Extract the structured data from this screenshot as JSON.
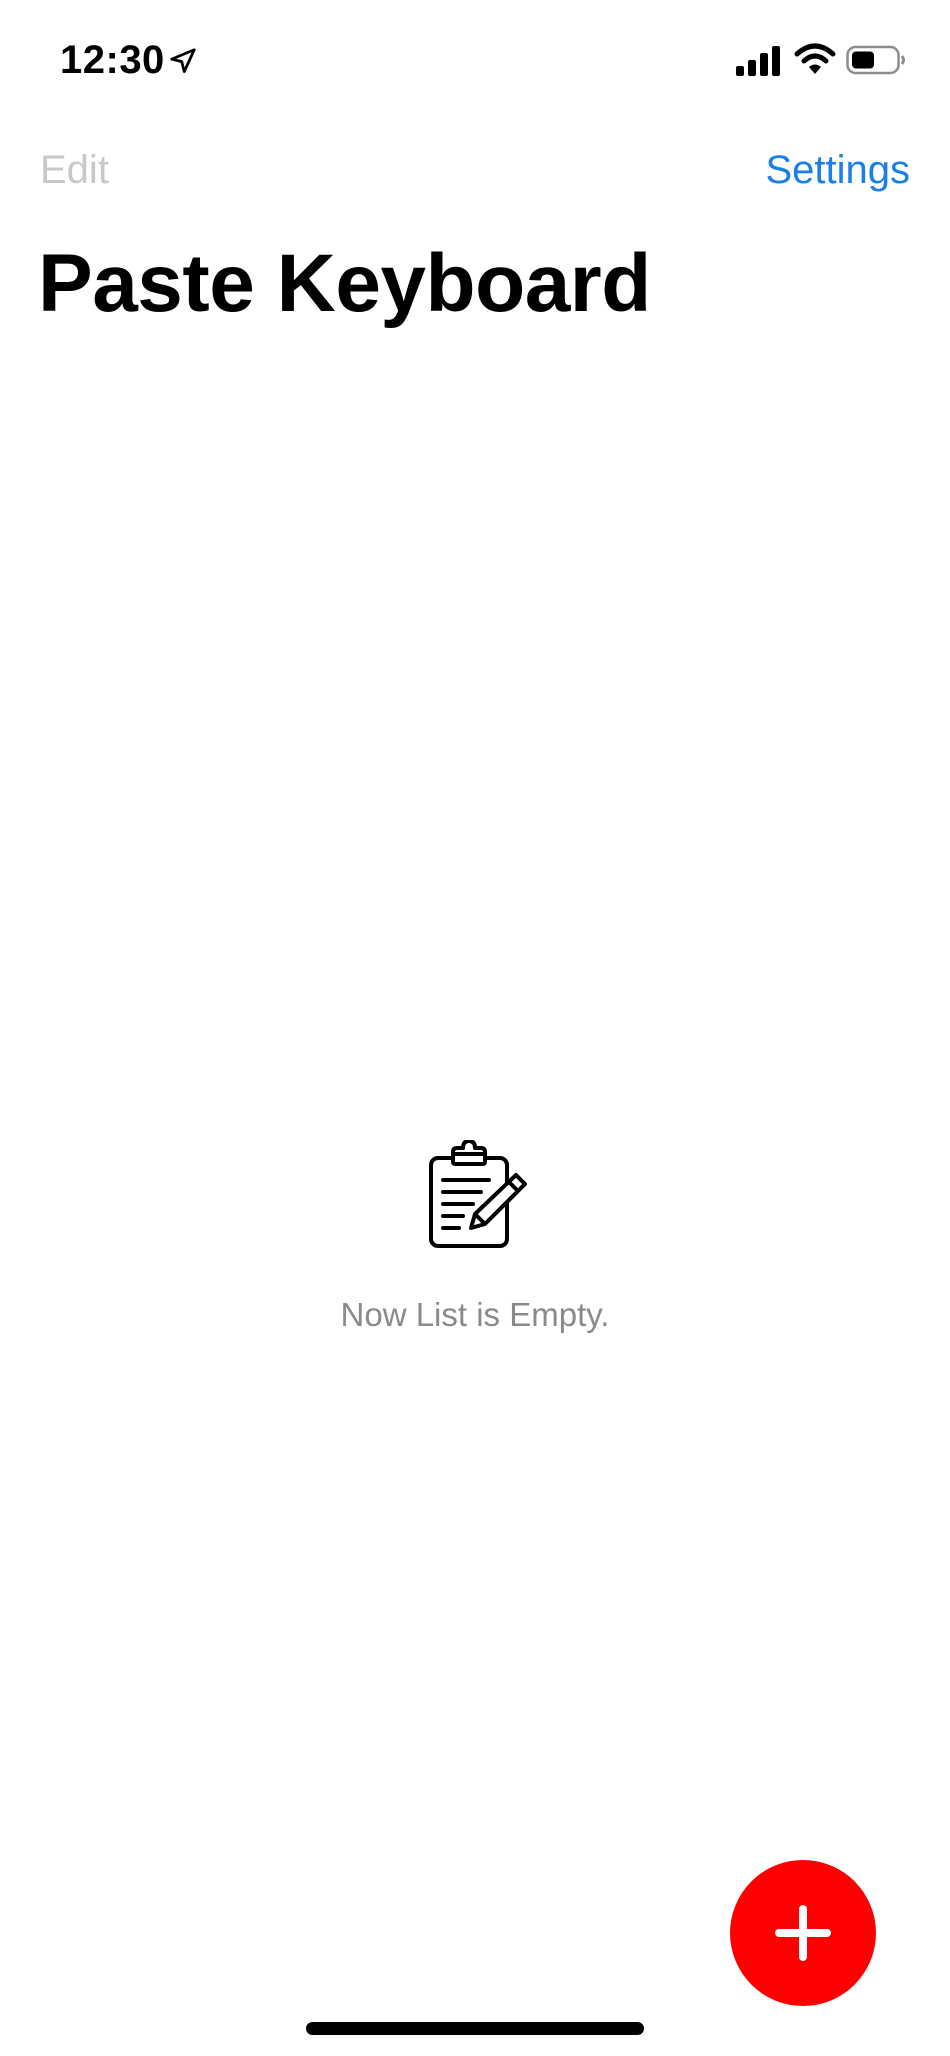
{
  "status_bar": {
    "time": "12:30",
    "icons": [
      "location-arrow-icon",
      "cellular-signal-icon",
      "wifi-icon",
      "battery-icon"
    ]
  },
  "nav": {
    "edit_label": "Edit",
    "settings_label": "Settings",
    "edit_color": "#c7c7cc",
    "settings_color": "#1a7fe6"
  },
  "title": "Paste Keyboard",
  "empty_state": {
    "icon": "clipboard-edit-icon",
    "message": "Now List is Empty."
  },
  "fab": {
    "icon": "plus-icon",
    "color": "#ff0000"
  }
}
